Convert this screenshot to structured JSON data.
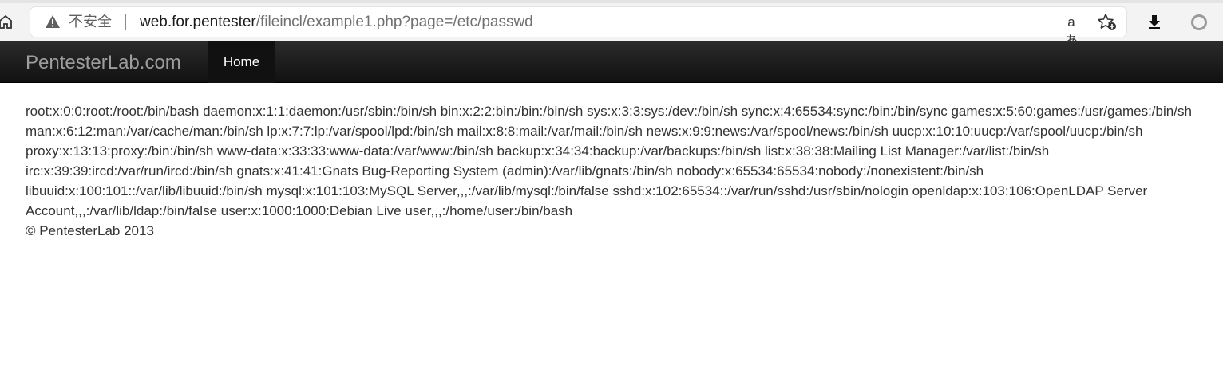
{
  "browser": {
    "security_label": "不安全",
    "url_host": "web.for.pentester",
    "url_path": "/fileincl/example1.php?page=/etc/passwd",
    "icons": [
      "home-icon",
      "warning-icon",
      "read-aloud-icon",
      "favorites-icon",
      "download-icon",
      "profile-icon"
    ],
    "read_aloud_glyph": "aあ"
  },
  "navbar": {
    "brand": "PentesterLab.com",
    "home_label": "Home"
  },
  "content": {
    "passwd": "root:x:0:0:root:/root:/bin/bash daemon:x:1:1:daemon:/usr/sbin:/bin/sh bin:x:2:2:bin:/bin:/bin/sh sys:x:3:3:sys:/dev:/bin/sh sync:x:4:65534:sync:/bin:/bin/sync games:x:5:60:games:/usr/games:/bin/sh man:x:6:12:man:/var/cache/man:/bin/sh lp:x:7:7:lp:/var/spool/lpd:/bin/sh mail:x:8:8:mail:/var/mail:/bin/sh news:x:9:9:news:/var/spool/news:/bin/sh uucp:x:10:10:uucp:/var/spool/uucp:/bin/sh proxy:x:13:13:proxy:/bin:/bin/sh www-data:x:33:33:www-data:/var/www:/bin/sh backup:x:34:34:backup:/var/backups:/bin/sh list:x:38:38:Mailing List Manager:/var/list:/bin/sh irc:x:39:39:ircd:/var/run/ircd:/bin/sh gnats:x:41:41:Gnats Bug-Reporting System (admin):/var/lib/gnats:/bin/sh nobody:x:65534:65534:nobody:/nonexistent:/bin/sh libuuid:x:100:101::/var/lib/libuuid:/bin/sh mysql:x:101:103:MySQL Server,,,:/var/lib/mysql:/bin/false sshd:x:102:65534::/var/run/sshd:/usr/sbin/nologin openldap:x:103:106:OpenLDAP Server Account,,,:/var/lib/ldap:/bin/false user:x:1000:1000:Debian Live user,,,:/home/user:/bin/bash",
    "footer": "© PentesterLab 2013"
  },
  "colors": {
    "navbar_bg": "#1b1b1b",
    "brand_text": "#9d9d9d",
    "body_text": "#333333"
  }
}
